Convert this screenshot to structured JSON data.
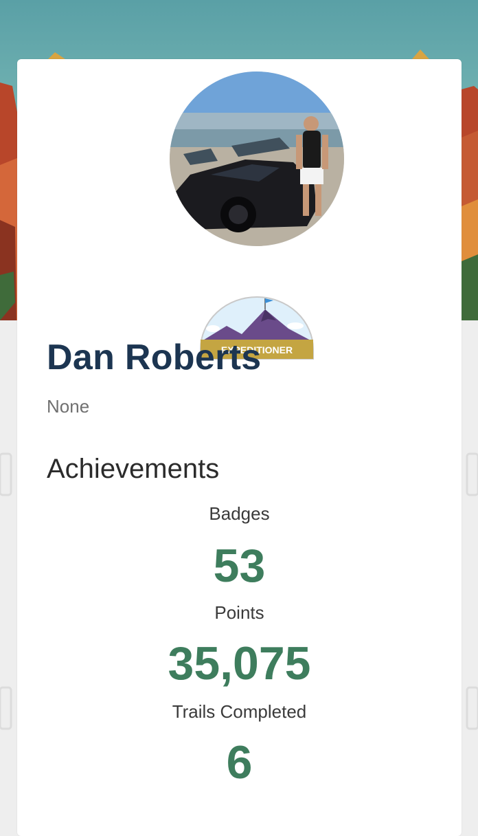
{
  "profile": {
    "name": "Dan Roberts",
    "company": "None",
    "rank": "EXPEDITIONER"
  },
  "achievements": {
    "title": "Achievements",
    "badges_label": "Badges",
    "badges_value": "53",
    "points_label": "Points",
    "points_value": "35,075",
    "trails_label": "Trails Completed",
    "trails_value": "6"
  },
  "colors": {
    "name": "#1c3551",
    "stat_value": "#3e7d5d",
    "rank_banner": "#c4a542"
  }
}
